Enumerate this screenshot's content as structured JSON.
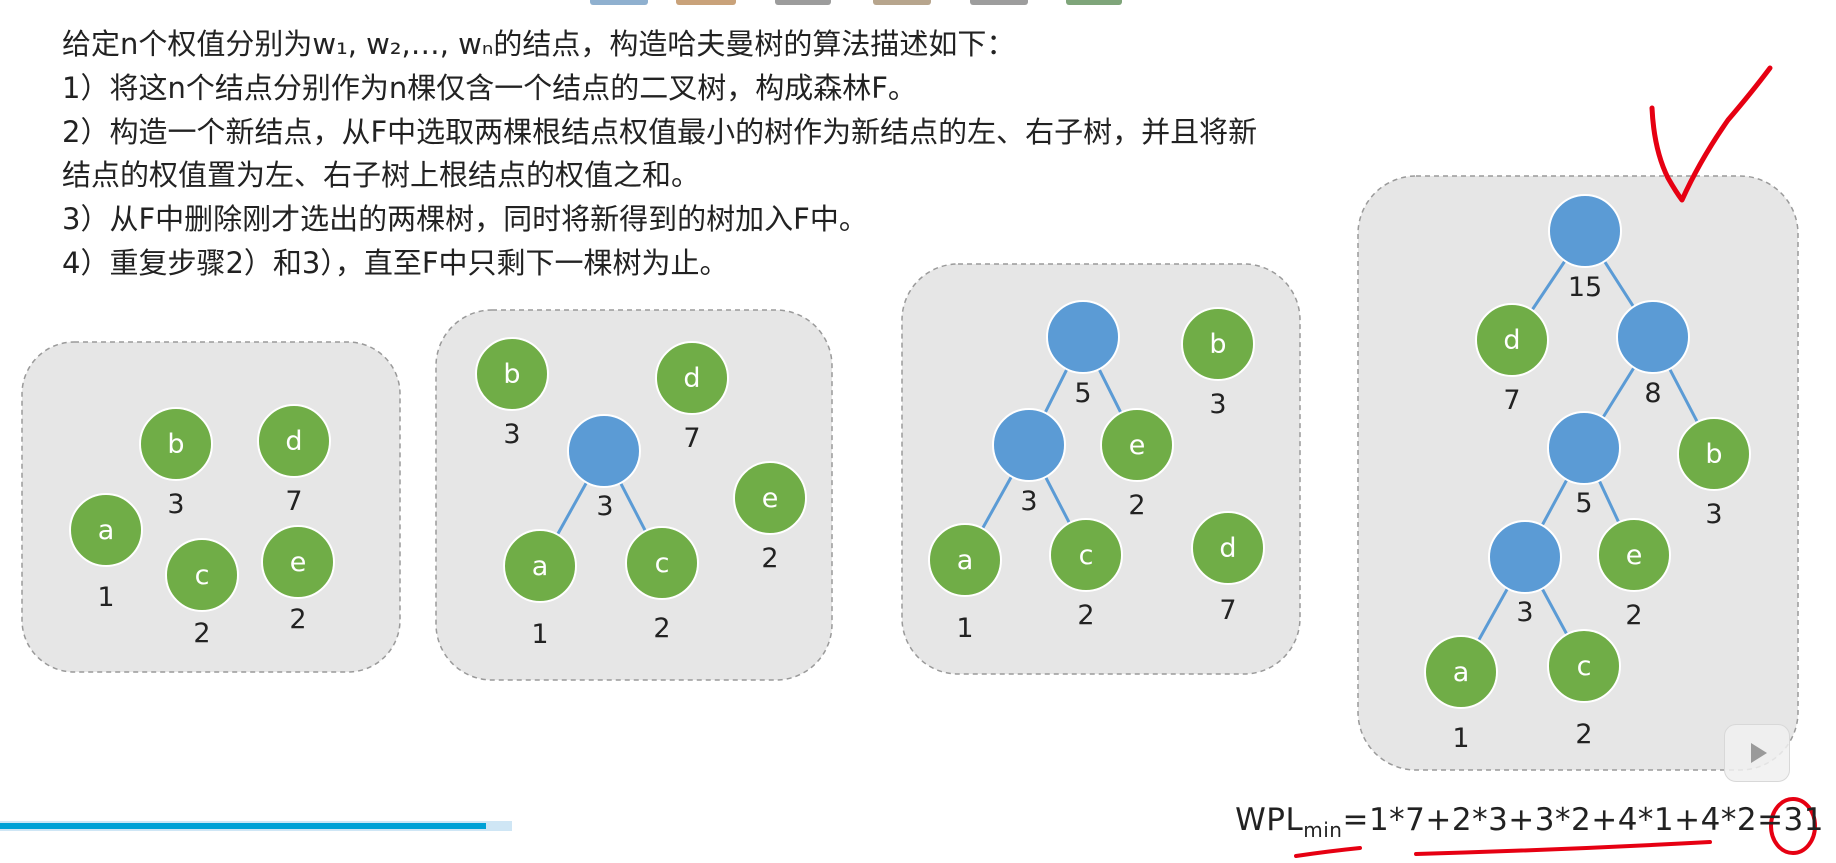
{
  "intro": "给定n个权值分别为w₁, w₂,…, wₙ的结点，构造哈夫曼树的算法描述如下：",
  "steps": [
    "1）将这n个结点分别作为n棵仅含一个结点的二叉树，构成森林F。",
    "2）构造一个新结点，从F中选取两棵根结点权值最小的树作为新结点的左、右子树，并且将新",
    "结点的权值置为左、右子树上根结点的权值之和。",
    "3）从F中删除刚才选出的两棵树，同时将新得到的树加入F中。",
    "4）重复步骤2）和3），直至F中只剩下一棵树为止。"
  ],
  "colors": {
    "leaf": "#70ad47",
    "internal": "#5b9bd5",
    "edge": "#5b9bd5",
    "panel": "#e6e6e6",
    "annotation": "#e60012",
    "progress": "#00a1d6"
  },
  "forests": [
    {
      "nodes": [
        {
          "id": "b",
          "label": "b",
          "weight": "3",
          "kind": "leaf"
        },
        {
          "id": "d",
          "label": "d",
          "weight": "7",
          "kind": "leaf"
        },
        {
          "id": "a",
          "label": "a",
          "weight": "1",
          "kind": "leaf"
        },
        {
          "id": "c",
          "label": "c",
          "weight": "2",
          "kind": "leaf"
        },
        {
          "id": "e",
          "label": "e",
          "weight": "2",
          "kind": "leaf"
        }
      ],
      "edges": []
    },
    {
      "nodes": [
        {
          "id": "b",
          "label": "b",
          "weight": "3",
          "kind": "leaf"
        },
        {
          "id": "d",
          "label": "d",
          "weight": "7",
          "kind": "leaf"
        },
        {
          "id": "n3",
          "label": "",
          "weight": "3",
          "kind": "internal"
        },
        {
          "id": "e",
          "label": "e",
          "weight": "2",
          "kind": "leaf"
        },
        {
          "id": "a",
          "label": "a",
          "weight": "1",
          "kind": "leaf"
        },
        {
          "id": "c",
          "label": "c",
          "weight": "2",
          "kind": "leaf"
        }
      ],
      "edges": [
        [
          "n3",
          "a"
        ],
        [
          "n3",
          "c"
        ]
      ]
    },
    {
      "nodes": [
        {
          "id": "n5",
          "label": "",
          "weight": "5",
          "kind": "internal"
        },
        {
          "id": "b",
          "label": "b",
          "weight": "3",
          "kind": "leaf"
        },
        {
          "id": "n3",
          "label": "",
          "weight": "3",
          "kind": "internal"
        },
        {
          "id": "e",
          "label": "e",
          "weight": "2",
          "kind": "leaf"
        },
        {
          "id": "a",
          "label": "a",
          "weight": "1",
          "kind": "leaf"
        },
        {
          "id": "c",
          "label": "c",
          "weight": "2",
          "kind": "leaf"
        },
        {
          "id": "d",
          "label": "d",
          "weight": "7",
          "kind": "leaf"
        }
      ],
      "edges": [
        [
          "n5",
          "n3"
        ],
        [
          "n5",
          "e"
        ],
        [
          "n3",
          "a"
        ],
        [
          "n3",
          "c"
        ]
      ]
    },
    {
      "nodes": [
        {
          "id": "n15",
          "label": "",
          "weight": "15",
          "kind": "internal"
        },
        {
          "id": "d",
          "label": "d",
          "weight": "7",
          "kind": "leaf"
        },
        {
          "id": "n8",
          "label": "",
          "weight": "8",
          "kind": "internal"
        },
        {
          "id": "n5",
          "label": "",
          "weight": "5",
          "kind": "internal"
        },
        {
          "id": "b",
          "label": "b",
          "weight": "3",
          "kind": "leaf"
        },
        {
          "id": "n3",
          "label": "",
          "weight": "3",
          "kind": "internal"
        },
        {
          "id": "e",
          "label": "e",
          "weight": "2",
          "kind": "leaf"
        },
        {
          "id": "a",
          "label": "a",
          "weight": "1",
          "kind": "leaf"
        },
        {
          "id": "c",
          "label": "c",
          "weight": "2",
          "kind": "leaf"
        }
      ],
      "edges": [
        [
          "n15",
          "d"
        ],
        [
          "n15",
          "n8"
        ],
        [
          "n8",
          "n5"
        ],
        [
          "n8",
          "b"
        ],
        [
          "n5",
          "n3"
        ],
        [
          "n5",
          "e"
        ],
        [
          "n3",
          "a"
        ],
        [
          "n3",
          "c"
        ]
      ]
    }
  ],
  "wpl": {
    "prefix": "WPL",
    "subscript": "min",
    "expression": "=1*7+2*3+3*2+4*1+4*2=31"
  },
  "player": {
    "progress": 0.95
  }
}
